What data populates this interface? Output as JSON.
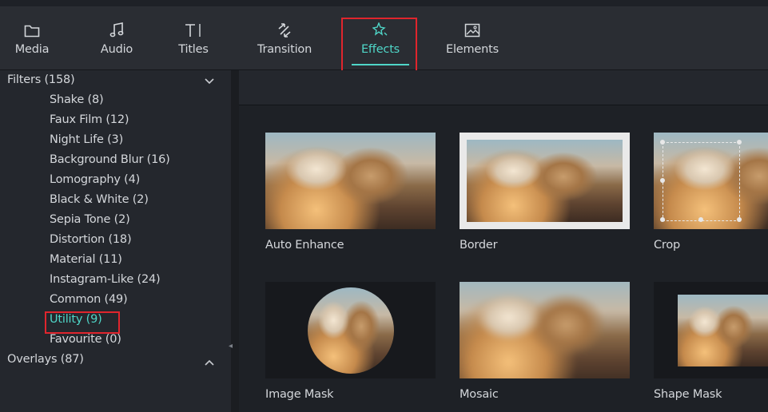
{
  "toolbar": {
    "tabs": [
      {
        "label": "Media",
        "icon": "folder-icon"
      },
      {
        "label": "Audio",
        "icon": "music-note-icon"
      },
      {
        "label": "Titles",
        "icon": "text-cursor-icon"
      },
      {
        "label": "Transition",
        "icon": "transition-arrows-icon"
      },
      {
        "label": "Effects",
        "icon": "sparkle-star-icon"
      },
      {
        "label": "Elements",
        "icon": "image-icon"
      }
    ],
    "active_tab": "Effects"
  },
  "sidebar": {
    "filters": {
      "label": "Filters (158)",
      "expanded": true
    },
    "subcategories": [
      {
        "label": "Shake (8)"
      },
      {
        "label": "Faux Film (12)"
      },
      {
        "label": "Night Life (3)"
      },
      {
        "label": "Background Blur (16)"
      },
      {
        "label": "Lomography (4)"
      },
      {
        "label": "Black & White (2)"
      },
      {
        "label": "Sepia Tone (2)"
      },
      {
        "label": "Distortion (18)"
      },
      {
        "label": "Material (11)"
      },
      {
        "label": "Instagram-Like (24)"
      },
      {
        "label": "Common (49)"
      },
      {
        "label": "Utility (9)"
      },
      {
        "label": "Favourite (0)"
      }
    ],
    "selected": "Utility (9)",
    "overlays": {
      "label": "Overlays (87)",
      "expanded": false
    }
  },
  "effects": [
    {
      "label": "Auto Enhance"
    },
    {
      "label": "Border"
    },
    {
      "label": "Crop"
    },
    {
      "label": "Image Mask"
    },
    {
      "label": "Mosaic"
    },
    {
      "label": "Shape Mask"
    }
  ],
  "colors": {
    "accent": "#4fd6c8",
    "highlight": "#e0252d",
    "panel": "#24272d",
    "topbar": "#2a2d33"
  }
}
